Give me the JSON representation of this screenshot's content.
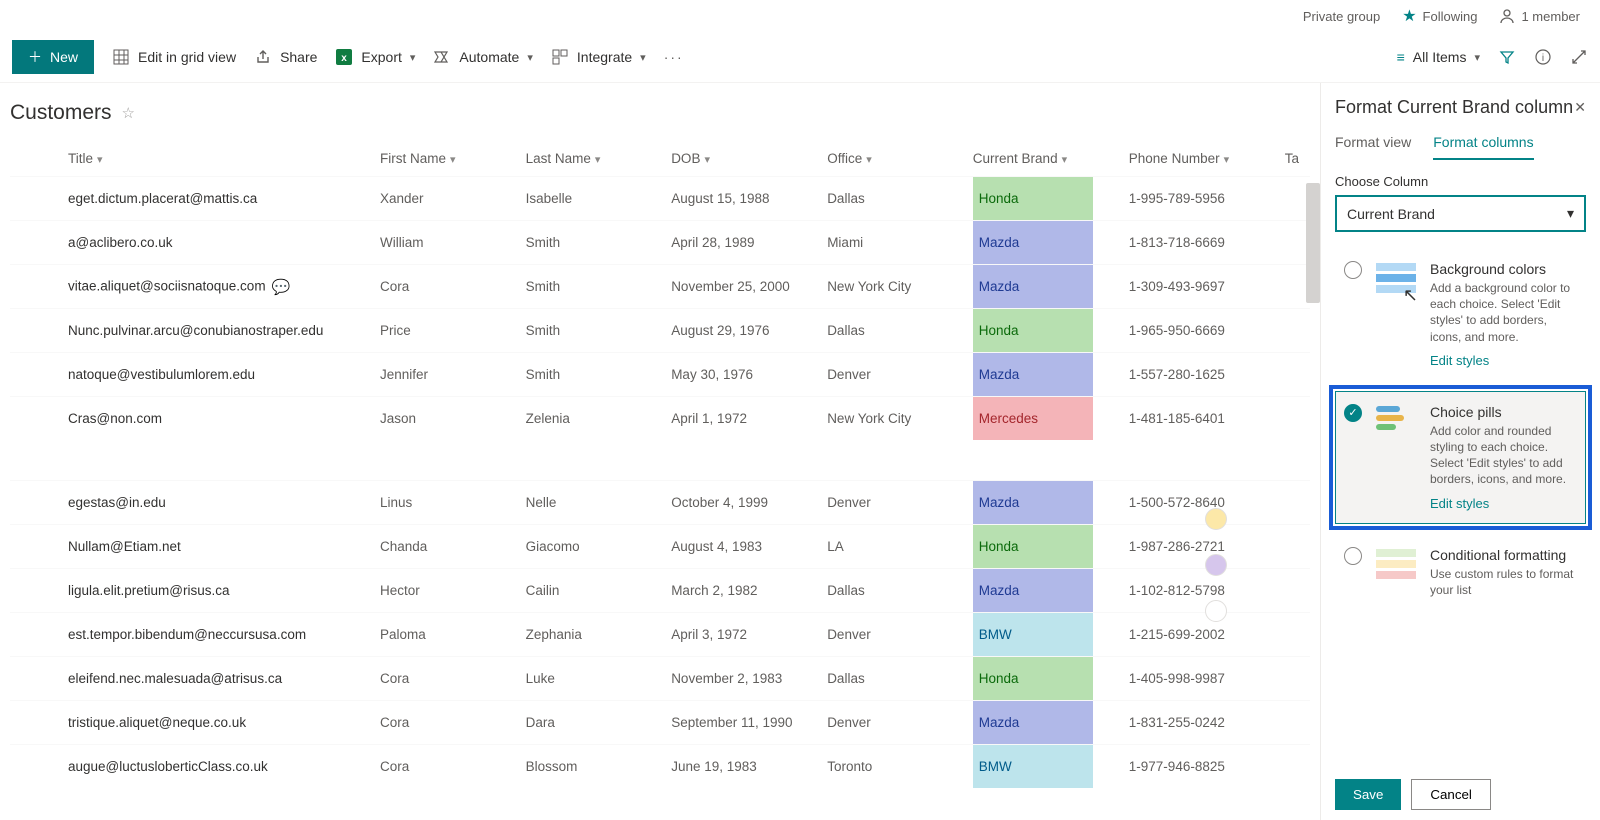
{
  "topbar": {
    "group": "Private group",
    "following": "Following",
    "members": "1 member"
  },
  "cmd": {
    "new": "New",
    "edit": "Edit in grid view",
    "share": "Share",
    "export": "Export",
    "automate": "Automate",
    "integrate": "Integrate",
    "allitems": "All Items"
  },
  "list": {
    "title": "Customers"
  },
  "columns": {
    "title": "Title",
    "first": "First Name",
    "last": "Last Name",
    "dob": "DOB",
    "office": "Office",
    "brand": "Current Brand",
    "phone": "Phone Number",
    "tags": "Ta"
  },
  "rows": [
    {
      "title": "eget.dictum.placerat@mattis.ca",
      "first": "Xander",
      "last": "Isabelle",
      "dob": "August 15, 1988",
      "office": "Dallas",
      "brand": "Honda",
      "phone": "1-995-789-5956",
      "comment": false
    },
    {
      "title": "a@aclibero.co.uk",
      "first": "William",
      "last": "Smith",
      "dob": "April 28, 1989",
      "office": "Miami",
      "brand": "Mazda",
      "phone": "1-813-718-6669",
      "comment": false
    },
    {
      "title": "vitae.aliquet@sociisnatoque.com",
      "first": "Cora",
      "last": "Smith",
      "dob": "November 25, 2000",
      "office": "New York City",
      "brand": "Mazda",
      "phone": "1-309-493-9697",
      "comment": true
    },
    {
      "title": "Nunc.pulvinar.arcu@conubianostraper.edu",
      "first": "Price",
      "last": "Smith",
      "dob": "August 29, 1976",
      "office": "Dallas",
      "brand": "Honda",
      "phone": "1-965-950-6669",
      "comment": false
    },
    {
      "title": "natoque@vestibulumlorem.edu",
      "first": "Jennifer",
      "last": "Smith",
      "dob": "May 30, 1976",
      "office": "Denver",
      "brand": "Mazda",
      "phone": "1-557-280-1625",
      "comment": false
    },
    {
      "title": "Cras@non.com",
      "first": "Jason",
      "last": "Zelenia",
      "dob": "April 1, 1972",
      "office": "New York City",
      "brand": "Mercedes",
      "phone": "1-481-185-6401",
      "comment": false
    },
    {
      "gap": true
    },
    {
      "title": "egestas@in.edu",
      "first": "Linus",
      "last": "Nelle",
      "dob": "October 4, 1999",
      "office": "Denver",
      "brand": "Mazda",
      "phone": "1-500-572-8640",
      "comment": false
    },
    {
      "title": "Nullam@Etiam.net",
      "first": "Chanda",
      "last": "Giacomo",
      "dob": "August 4, 1983",
      "office": "LA",
      "brand": "Honda",
      "phone": "1-987-286-2721",
      "comment": false
    },
    {
      "title": "ligula.elit.pretium@risus.ca",
      "first": "Hector",
      "last": "Cailin",
      "dob": "March 2, 1982",
      "office": "Dallas",
      "brand": "Mazda",
      "phone": "1-102-812-5798",
      "comment": false
    },
    {
      "title": "est.tempor.bibendum@neccursusa.com",
      "first": "Paloma",
      "last": "Zephania",
      "dob": "April 3, 1972",
      "office": "Denver",
      "brand": "BMW",
      "phone": "1-215-699-2002",
      "comment": false
    },
    {
      "title": "eleifend.nec.malesuada@atrisus.ca",
      "first": "Cora",
      "last": "Luke",
      "dob": "November 2, 1983",
      "office": "Dallas",
      "brand": "Honda",
      "phone": "1-405-998-9987",
      "comment": false
    },
    {
      "title": "tristique.aliquet@neque.co.uk",
      "first": "Cora",
      "last": "Dara",
      "dob": "September 11, 1990",
      "office": "Denver",
      "brand": "Mazda",
      "phone": "1-831-255-0242",
      "comment": false
    },
    {
      "title": "augue@luctusloberticClass.co.uk",
      "first": "Cora",
      "last": "Blossom",
      "dob": "June 19, 1983",
      "office": "Toronto",
      "brand": "BMW",
      "phone": "1-977-946-8825",
      "comment": false
    }
  ],
  "panel": {
    "title": "Format Current Brand column",
    "tab1": "Format view",
    "tab2": "Format columns",
    "choose": "Choose Column",
    "selected": "Current Brand",
    "opt1": {
      "title": "Background colors",
      "desc": "Add a background color to each choice. Select 'Edit styles' to add borders, icons, and more."
    },
    "opt2": {
      "title": "Choice pills",
      "desc": "Add color and rounded styling to each choice. Select 'Edit styles' to add borders, icons, and more."
    },
    "opt3": {
      "title": "Conditional formatting",
      "desc": "Use custom rules to format your list"
    },
    "edit": "Edit styles",
    "save": "Save",
    "cancel": "Cancel"
  },
  "brandClass": {
    "Honda": "brand-honda",
    "Mazda": "brand-mazda",
    "Mercedes": "brand-mercedes",
    "BMW": "brand-bmw"
  }
}
